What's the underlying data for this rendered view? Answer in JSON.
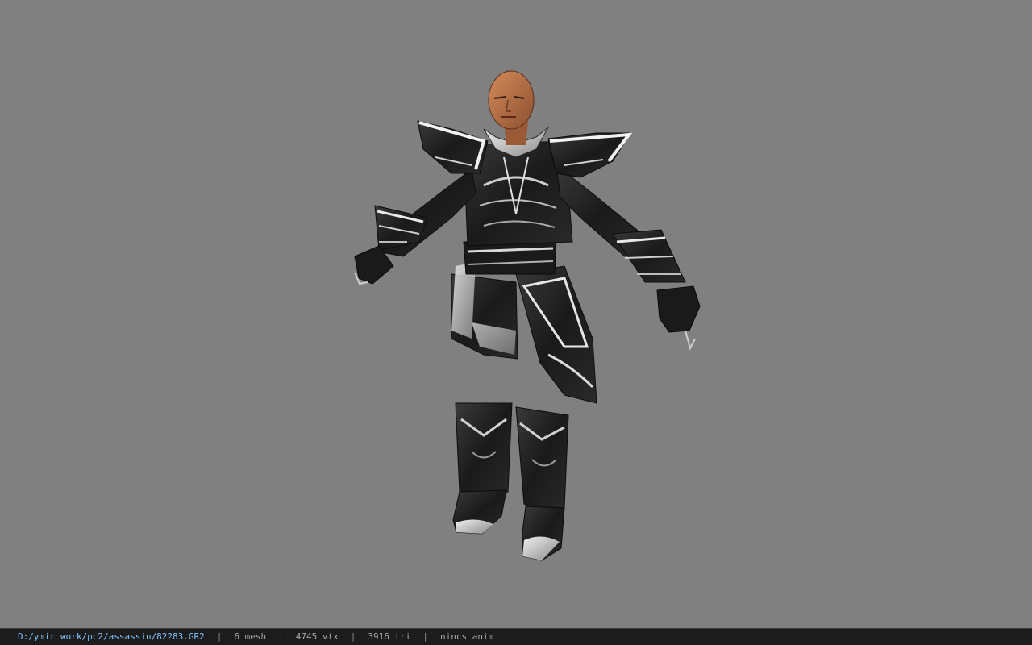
{
  "window": {
    "background_color": "#808080",
    "statusbar_color": "#1c1c1c"
  },
  "viewport": {
    "model_icon": "character-model-icon"
  },
  "statusbar": {
    "file_path": "D:/ymir work/pc2/assassin/82283.GR2",
    "separator": "|",
    "mesh_count": "6 mesh",
    "vertex_count": "4745 vtx",
    "triangle_count": "3916 tri",
    "anim_status": "nincs anim"
  }
}
